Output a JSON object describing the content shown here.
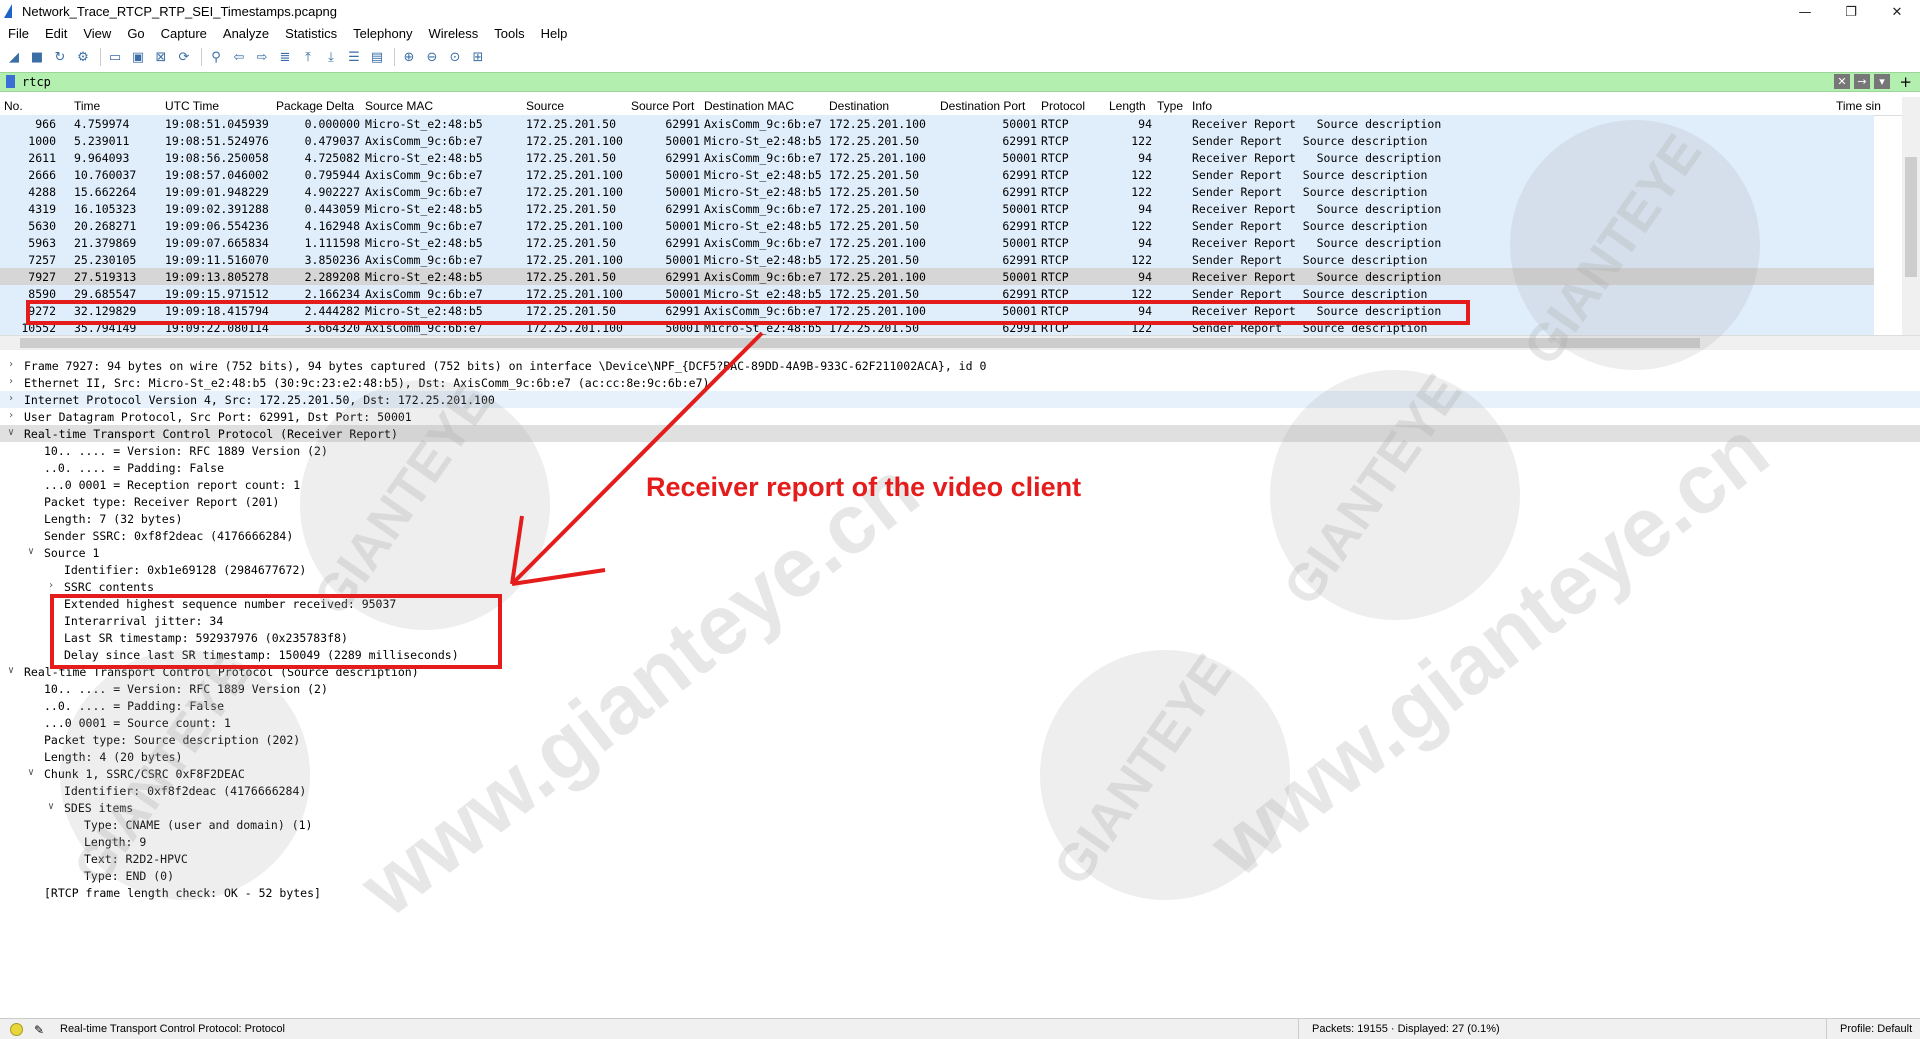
{
  "window": {
    "title": "Network_Trace_RTCP_RTP_SEI_Timestamps.pcapng",
    "controls": [
      "—",
      "❐",
      "✕"
    ]
  },
  "menu": [
    "File",
    "Edit",
    "View",
    "Go",
    "Capture",
    "Analyze",
    "Statistics",
    "Telephony",
    "Wireless",
    "Tools",
    "Help"
  ],
  "toolbar_icons": [
    "shark-fin-start-icon",
    "stop-icon",
    "restart-icon",
    "options-icon",
    "open-file-icon",
    "save-file-icon",
    "close-file-icon",
    "reload-icon",
    "find-icon",
    "back-icon",
    "forward-icon",
    "go-to-packet-icon",
    "first-packet-icon",
    "last-packet-icon",
    "autoscroll-icon",
    "colorize-icon",
    "zoom-in-icon",
    "zoom-out-icon",
    "normal-size-icon",
    "resize-columns-icon"
  ],
  "filter": {
    "value": "rtcp"
  },
  "packet_list": {
    "columns": [
      "No.",
      "Time",
      "UTC Time",
      "Package Delta",
      "Source MAC",
      "Source",
      "Source Port",
      "Destination MAC",
      "Destination",
      "Destination Port",
      "Protocol",
      "Length",
      "Type",
      "Info",
      "Time sin"
    ],
    "rows": [
      {
        "no": "966",
        "time": "4.759974",
        "utc": "19:08:51.045939",
        "delta": "0.000000",
        "smac": "Micro-St_e2:48:b5",
        "src": "172.25.201.50",
        "sport": "62991",
        "dmac": "AxisComm_9c:6b:e7",
        "dst": "172.25.201.100",
        "dport": "50001",
        "proto": "RTCP",
        "len": "94",
        "info": "Receiver Report   Source description"
      },
      {
        "no": "1000",
        "time": "5.239011",
        "utc": "19:08:51.524976",
        "delta": "0.479037",
        "smac": "AxisComm_9c:6b:e7",
        "src": "172.25.201.100",
        "sport": "50001",
        "dmac": "Micro-St_e2:48:b5",
        "dst": "172.25.201.50",
        "dport": "62991",
        "proto": "RTCP",
        "len": "122",
        "info": "Sender Report   Source description"
      },
      {
        "no": "2611",
        "time": "9.964093",
        "utc": "19:08:56.250058",
        "delta": "4.725082",
        "smac": "Micro-St_e2:48:b5",
        "src": "172.25.201.50",
        "sport": "62991",
        "dmac": "AxisComm_9c:6b:e7",
        "dst": "172.25.201.100",
        "dport": "50001",
        "proto": "RTCP",
        "len": "94",
        "info": "Receiver Report   Source description"
      },
      {
        "no": "2666",
        "time": "10.760037",
        "utc": "19:08:57.046002",
        "delta": "0.795944",
        "smac": "AxisComm_9c:6b:e7",
        "src": "172.25.201.100",
        "sport": "50001",
        "dmac": "Micro-St_e2:48:b5",
        "dst": "172.25.201.50",
        "dport": "62991",
        "proto": "RTCP",
        "len": "122",
        "info": "Sender Report   Source description"
      },
      {
        "no": "4288",
        "time": "15.662264",
        "utc": "19:09:01.948229",
        "delta": "4.902227",
        "smac": "AxisComm_9c:6b:e7",
        "src": "172.25.201.100",
        "sport": "50001",
        "dmac": "Micro-St_e2:48:b5",
        "dst": "172.25.201.50",
        "dport": "62991",
        "proto": "RTCP",
        "len": "122",
        "info": "Sender Report   Source description"
      },
      {
        "no": "4319",
        "time": "16.105323",
        "utc": "19:09:02.391288",
        "delta": "0.443059",
        "smac": "Micro-St_e2:48:b5",
        "src": "172.25.201.50",
        "sport": "62991",
        "dmac": "AxisComm_9c:6b:e7",
        "dst": "172.25.201.100",
        "dport": "50001",
        "proto": "RTCP",
        "len": "94",
        "info": "Receiver Report   Source description"
      },
      {
        "no": "5630",
        "time": "20.268271",
        "utc": "19:09:06.554236",
        "delta": "4.162948",
        "smac": "AxisComm_9c:6b:e7",
        "src": "172.25.201.100",
        "sport": "50001",
        "dmac": "Micro-St_e2:48:b5",
        "dst": "172.25.201.50",
        "dport": "62991",
        "proto": "RTCP",
        "len": "122",
        "info": "Sender Report   Source description"
      },
      {
        "no": "5963",
        "time": "21.379869",
        "utc": "19:09:07.665834",
        "delta": "1.111598",
        "smac": "Micro-St_e2:48:b5",
        "src": "172.25.201.50",
        "sport": "62991",
        "dmac": "AxisComm_9c:6b:e7",
        "dst": "172.25.201.100",
        "dport": "50001",
        "proto": "RTCP",
        "len": "94",
        "info": "Receiver Report   Source description"
      },
      {
        "no": "7257",
        "time": "25.230105",
        "utc": "19:09:11.516070",
        "delta": "3.850236",
        "smac": "AxisComm_9c:6b:e7",
        "src": "172.25.201.100",
        "sport": "50001",
        "dmac": "Micro-St_e2:48:b5",
        "dst": "172.25.201.50",
        "dport": "62991",
        "proto": "RTCP",
        "len": "122",
        "info": "Sender Report   Source description"
      },
      {
        "no": "7927",
        "time": "27.519313",
        "utc": "19:09:13.805278",
        "delta": "2.289208",
        "smac": "Micro-St_e2:48:b5",
        "src": "172.25.201.50",
        "sport": "62991",
        "dmac": "AxisComm_9c:6b:e7",
        "dst": "172.25.201.100",
        "dport": "50001",
        "proto": "RTCP",
        "len": "94",
        "info": "Receiver Report   Source description",
        "selected": true
      },
      {
        "no": "8590",
        "time": "29.685547",
        "utc": "19:09:15.971512",
        "delta": "2.166234",
        "smac": "AxisComm_9c:6b:e7",
        "src": "172.25.201.100",
        "sport": "50001",
        "dmac": "Micro-St_e2:48:b5",
        "dst": "172.25.201.50",
        "dport": "62991",
        "proto": "RTCP",
        "len": "122",
        "info": "Sender Report   Source description"
      },
      {
        "no": "9272",
        "time": "32.129829",
        "utc": "19:09:18.415794",
        "delta": "2.444282",
        "smac": "Micro-St_e2:48:b5",
        "src": "172.25.201.50",
        "sport": "62991",
        "dmac": "AxisComm_9c:6b:e7",
        "dst": "172.25.201.100",
        "dport": "50001",
        "proto": "RTCP",
        "len": "94",
        "info": "Receiver Report   Source description"
      },
      {
        "no": "10552",
        "time": "35.794149",
        "utc": "19:09:22.080114",
        "delta": "3.664320",
        "smac": "AxisComm_9c:6b:e7",
        "src": "172.25.201.100",
        "sport": "50001",
        "dmac": "Micro-St_e2:48:b5",
        "dst": "172.25.201.50",
        "dport": "62991",
        "proto": "RTCP",
        "len": "122",
        "info": "Sender Report   Source description"
      }
    ]
  },
  "details": [
    {
      "indent": 0,
      "arrow": ">",
      "text": "Frame 7927: 94 bytes on wire (752 bits), 94 bytes captured (752 bits) on interface \\Device\\NPF_{DCF5?BAC-89DD-4A9B-933C-62F211002ACA}, id 0"
    },
    {
      "indent": 0,
      "arrow": ">",
      "text": "Ethernet II, Src: Micro-St_e2:48:b5 (30:9c:23:e2:48:b5), Dst: AxisComm_9c:6b:e7 (ac:cc:8e:9c:6b:e7)"
    },
    {
      "indent": 0,
      "arrow": ">",
      "text": "Internet Protocol Version 4, Src: 172.25.201.50, Dst: 172.25.201.100",
      "lb": true
    },
    {
      "indent": 0,
      "arrow": ">",
      "text": "User Datagram Protocol, Src Port: 62991, Dst Port: 50001"
    },
    {
      "indent": 0,
      "arrow": "v",
      "text": "Real-time Transport Control Protocol (Receiver Report)",
      "hl": true
    },
    {
      "indent": 1,
      "arrow": "",
      "text": "10.. .... = Version: RFC 1889 Version (2)"
    },
    {
      "indent": 1,
      "arrow": "",
      "text": "..0. .... = Padding: False"
    },
    {
      "indent": 1,
      "arrow": "",
      "text": "...0 0001 = Reception report count: 1"
    },
    {
      "indent": 1,
      "arrow": "",
      "text": "Packet type: Receiver Report (201)"
    },
    {
      "indent": 1,
      "arrow": "",
      "text": "Length: 7 (32 bytes)"
    },
    {
      "indent": 1,
      "arrow": "",
      "text": "Sender SSRC: 0xf8f2deac (4176666284)"
    },
    {
      "indent": 1,
      "arrow": "v",
      "text": "Source 1"
    },
    {
      "indent": 2,
      "arrow": "",
      "text": "Identifier: 0xb1e69128 (2984677672)"
    },
    {
      "indent": 2,
      "arrow": ">",
      "text": "SSRC contents"
    },
    {
      "indent": 2,
      "arrow": "",
      "text": "Extended highest sequence number received: 95037"
    },
    {
      "indent": 2,
      "arrow": "",
      "text": "Interarrival jitter: 34"
    },
    {
      "indent": 2,
      "arrow": "",
      "text": "Last SR timestamp: 592937976 (0x235783f8)"
    },
    {
      "indent": 2,
      "arrow": "",
      "text": "Delay since last SR timestamp: 150049 (2289 milliseconds)"
    },
    {
      "indent": 0,
      "arrow": "v",
      "text": "Real-time Transport Control Protocol (Source description)"
    },
    {
      "indent": 1,
      "arrow": "",
      "text": "10.. .... = Version: RFC 1889 Version (2)"
    },
    {
      "indent": 1,
      "arrow": "",
      "text": "..0. .... = Padding: False"
    },
    {
      "indent": 1,
      "arrow": "",
      "text": "...0 0001 = Source count: 1"
    },
    {
      "indent": 1,
      "arrow": "",
      "text": "Packet type: Source description (202)"
    },
    {
      "indent": 1,
      "arrow": "",
      "text": "Length: 4 (20 bytes)"
    },
    {
      "indent": 1,
      "arrow": "v",
      "text": "Chunk 1, SSRC/CSRC 0xF8F2DEAC"
    },
    {
      "indent": 2,
      "arrow": "",
      "text": "Identifier: 0xf8f2deac (4176666284)"
    },
    {
      "indent": 2,
      "arrow": "v",
      "text": "SDES items"
    },
    {
      "indent": 3,
      "arrow": "",
      "text": "Type: CNAME (user and domain) (1)"
    },
    {
      "indent": 3,
      "arrow": "",
      "text": "Length: 9"
    },
    {
      "indent": 3,
      "arrow": "",
      "text": "Text: R2D2-HPVC"
    },
    {
      "indent": 3,
      "arrow": "",
      "text": "Type: END (0)"
    },
    {
      "indent": 1,
      "arrow": "",
      "text": "[RTCP frame length check: OK - 52 bytes]"
    }
  ],
  "annotation": {
    "label": "Receiver report of the video client",
    "color": "#e41c1c"
  },
  "watermark": {
    "brand": "GIANTEYE",
    "url": "www.gianteye.cn"
  },
  "statusbar": {
    "protocol_text": "Real-time Transport Control Protocol: Protocol",
    "packets_text": "Packets: 19155 · Displayed: 27 (0.1%)",
    "profile_text": "Profile: Default"
  }
}
